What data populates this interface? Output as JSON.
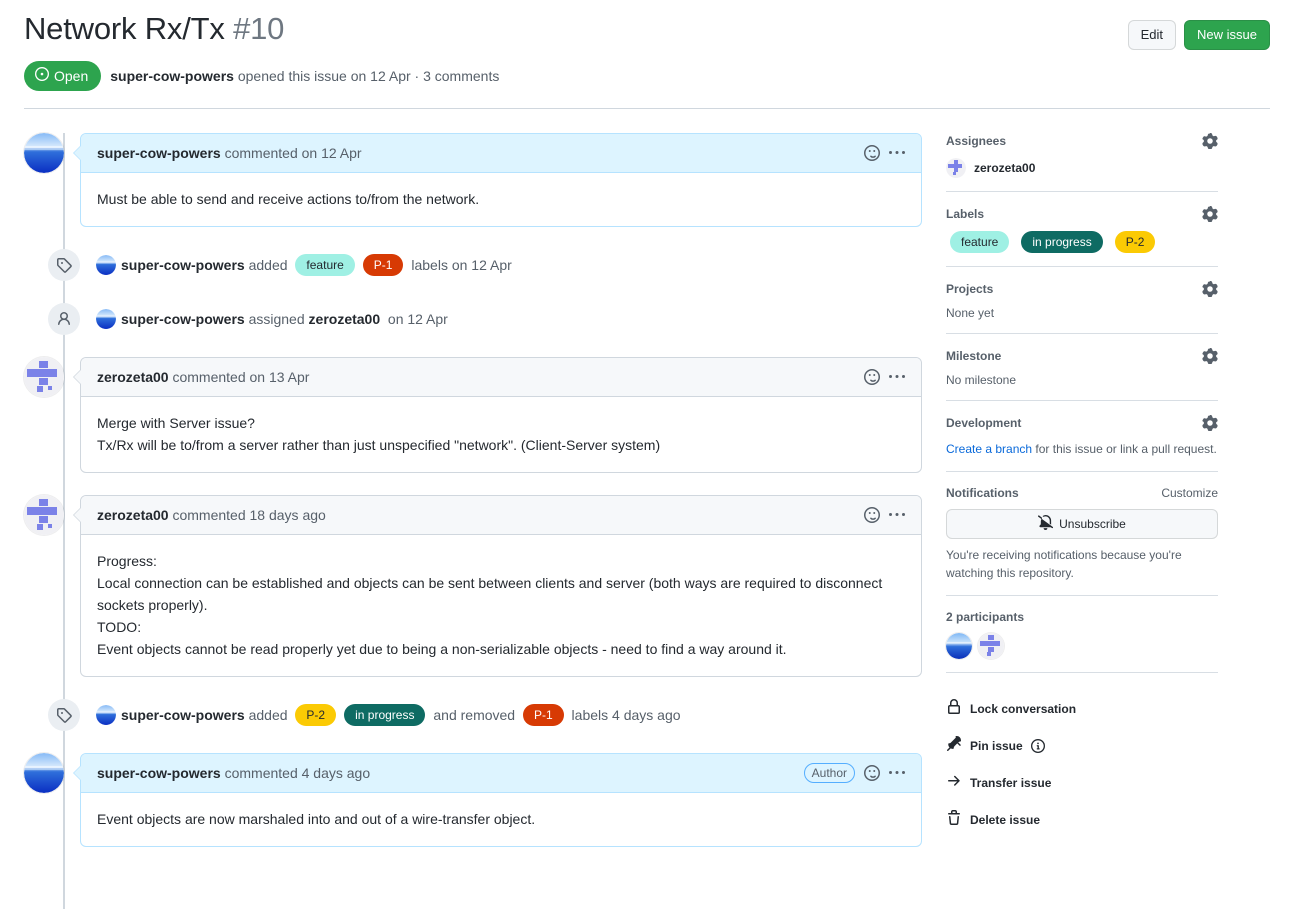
{
  "header": {
    "title": "Network Rx/Tx",
    "number": "#10",
    "edit_label": "Edit",
    "new_issue_label": "New issue",
    "state": "Open",
    "author": "super-cow-powers",
    "opened_text": "opened this issue on 12 Apr",
    "separator": "·",
    "comments_count": "3 comments"
  },
  "timeline": [
    {
      "kind": "comment",
      "author": "super-cow-powers",
      "avatar": "photo",
      "is_author": true,
      "meta": "commented on 12 Apr",
      "badge": "",
      "body": "Must be able to send and receive actions to/from the network."
    },
    {
      "kind": "event",
      "icon": "tag-icon",
      "actor": "super-cow-powers",
      "avatar": "photo",
      "verb": "added",
      "labels": [
        {
          "name": "feature",
          "bg": "#9ff0e4",
          "fg": "#24292f"
        },
        {
          "name": "P-1",
          "bg": "#d73a04",
          "fg": "#ffffff"
        }
      ],
      "tail": "labels on 12 Apr"
    },
    {
      "kind": "event",
      "icon": "person-icon",
      "actor": "super-cow-powers",
      "avatar": "photo",
      "verb": "assigned",
      "target": "zerozeta00",
      "tail": "on 12 Apr"
    },
    {
      "kind": "comment",
      "author": "zerozeta00",
      "avatar": "identicon",
      "is_author": false,
      "meta": "commented on 13 Apr",
      "badge": "",
      "body": "Merge with Server issue?\nTx/Rx will be to/from a server rather than just unspecified \"network\". (Client-Server system)"
    },
    {
      "kind": "comment",
      "author": "zerozeta00",
      "avatar": "identicon",
      "is_author": false,
      "meta": "commented 18 days ago",
      "badge": "",
      "body": "Progress:\nLocal connection can be established and objects can be sent between clients and server (both ways are required to disconnect sockets properly).\nTODO:\nEvent objects cannot be read properly yet due to being a non-serializable objects - need to find a way around it."
    },
    {
      "kind": "event",
      "icon": "tag-icon",
      "actor": "super-cow-powers",
      "avatar": "photo",
      "verb": "added",
      "labels": [
        {
          "name": "P-2",
          "bg": "#fbca04",
          "fg": "#24292f"
        },
        {
          "name": "in progress",
          "bg": "#0e6b63",
          "fg": "#ffffff"
        }
      ],
      "mid": "and removed",
      "labels2": [
        {
          "name": "P-1",
          "bg": "#d73a04",
          "fg": "#ffffff"
        }
      ],
      "tail": "labels 4 days ago"
    },
    {
      "kind": "comment",
      "author": "super-cow-powers",
      "avatar": "photo",
      "is_author": true,
      "meta": "commented 4 days ago",
      "badge": "Author",
      "body": "Event objects are now marshaled into and out of a wire-transfer object."
    }
  ],
  "sidebar": {
    "assignees": {
      "title": "Assignees",
      "gear": "gear-icon",
      "user": "zerozeta00"
    },
    "labels": {
      "title": "Labels",
      "gear": "gear-icon",
      "items": [
        {
          "name": "feature",
          "bg": "#9ff0e4",
          "fg": "#24292f"
        },
        {
          "name": "in progress",
          "bg": "#0e6b63",
          "fg": "#ffffff"
        },
        {
          "name": "P-2",
          "bg": "#fbca04",
          "fg": "#24292f"
        }
      ]
    },
    "projects": {
      "title": "Projects",
      "gear": "gear-icon",
      "empty": "None yet"
    },
    "milestone": {
      "title": "Milestone",
      "gear": "gear-icon",
      "empty": "No milestone"
    },
    "development": {
      "title": "Development",
      "gear": "gear-icon",
      "link": "Create a branch",
      "rest": " for this issue or link a pull request."
    },
    "notifications": {
      "title": "Notifications",
      "customize": "Customize",
      "button": "Unsubscribe",
      "description": "You're receiving notifications because you're watching this repository."
    },
    "participants": {
      "title": "2 participants"
    },
    "actions": [
      {
        "label": "Lock conversation",
        "icon": "lock-icon"
      },
      {
        "label": "Pin issue",
        "icon": "pin-icon",
        "info": true
      },
      {
        "label": "Transfer issue",
        "icon": "arrow-right-icon"
      },
      {
        "label": "Delete issue",
        "icon": "trash-icon"
      }
    ]
  }
}
